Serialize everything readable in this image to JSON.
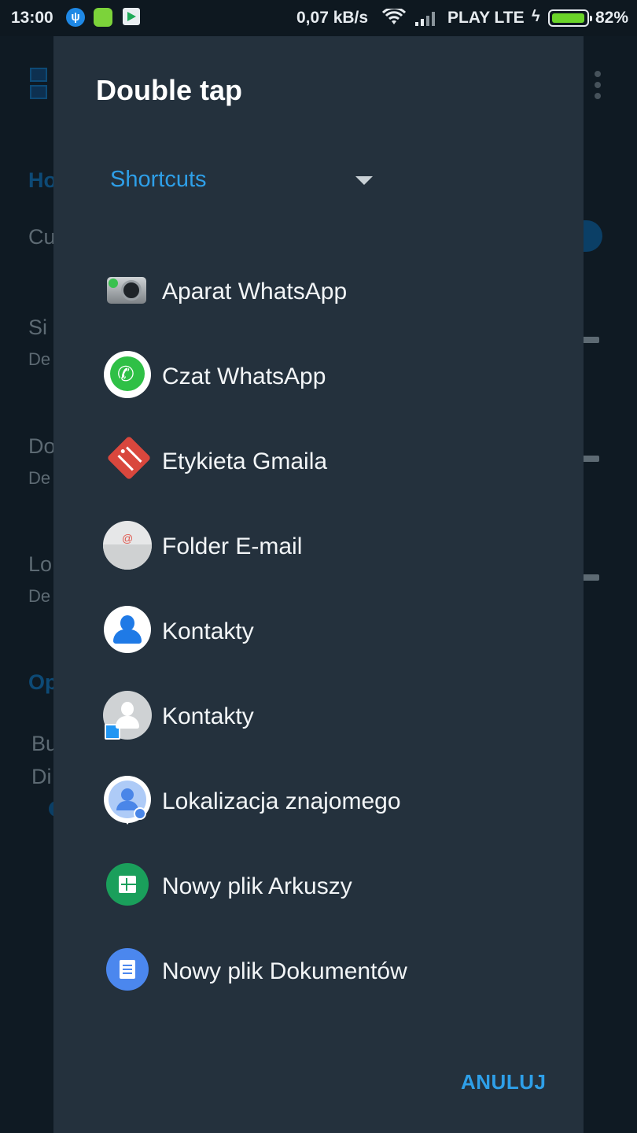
{
  "status_bar": {
    "time": "13:00",
    "net_speed": "0,07 kB/s",
    "carrier": "PLAY LTE",
    "battery_percent": "82%",
    "battery_level": 0.82,
    "usb_icon_glyph": "ψ"
  },
  "background": {
    "section_home": "Ho",
    "row1_title": "Cu",
    "row2_title": "Si",
    "row2_sub": "De",
    "row3_title": "Do",
    "row3_sub": "De",
    "row4_title": "Lo",
    "row4_sub": "De",
    "section_other": "Op",
    "row5_title": "Bu",
    "row5_sub": "Di"
  },
  "dialog": {
    "title": "Double tap",
    "dropdown_value": "Shortcuts",
    "items": [
      {
        "label": "Aparat WhatsApp",
        "icon": "whatsapp-camera-icon"
      },
      {
        "label": "Czat WhatsApp",
        "icon": "whatsapp-icon"
      },
      {
        "label": "Etykieta Gmaila",
        "icon": "gmail-label-icon"
      },
      {
        "label": "Folder E-mail",
        "icon": "email-folder-icon"
      },
      {
        "label": "Kontakty",
        "icon": "contacts-blue-icon"
      },
      {
        "label": "Kontakty",
        "icon": "contacts-grey-icon"
      },
      {
        "label": "Lokalizacja znajomego",
        "icon": "friend-location-icon"
      },
      {
        "label": "Nowy plik Arkuszy",
        "icon": "sheets-icon"
      },
      {
        "label": "Nowy plik Dokumentów",
        "icon": "docs-icon"
      }
    ],
    "cancel_label": "ANULUJ"
  }
}
